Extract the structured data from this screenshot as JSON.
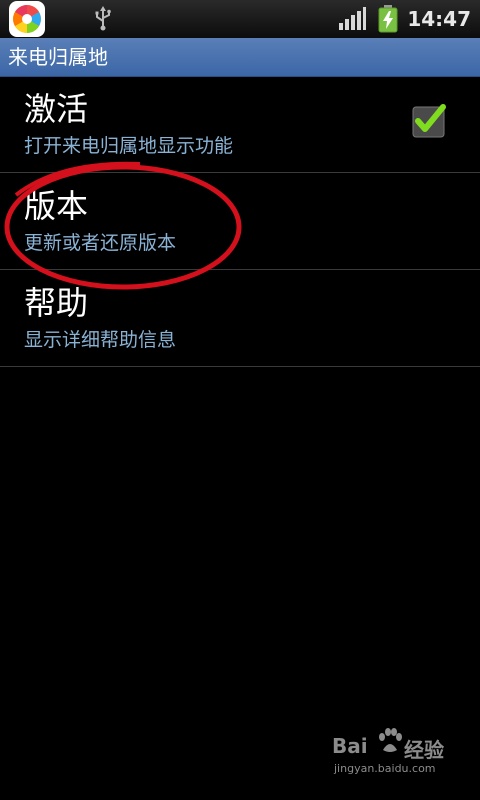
{
  "status_bar": {
    "time": "14:47",
    "icons": [
      "app-icon",
      "usb-icon",
      "signal-icon",
      "battery-charging-icon"
    ]
  },
  "title_bar": {
    "title": "来电归属地"
  },
  "preferences": [
    {
      "title": "激活",
      "summary": "打开来电归属地显示功能",
      "checked": true
    },
    {
      "title": "版本",
      "summary": "更新或者还原版本"
    },
    {
      "title": "帮助",
      "summary": "显示详细帮助信息"
    }
  ],
  "colors": {
    "title_bar": "#4a74b0",
    "summary_text": "#8ab2d4",
    "check_green": "#7fdc1f",
    "annotation_red": "#d4101c",
    "background": "#000000"
  },
  "watermark": {
    "brand_left": "Bai",
    "brand_right": "经验",
    "url": "jingyan.baidu.com"
  }
}
